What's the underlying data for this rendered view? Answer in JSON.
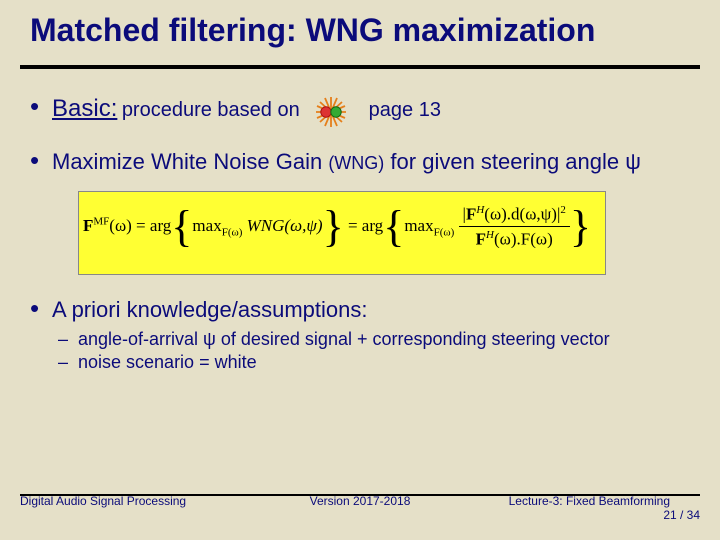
{
  "title": "Matched filtering: WNG maximization",
  "bullets": {
    "b1": {
      "basic_label": "Basic:",
      "basic_rest": "procedure based on",
      "page_ref": "page 13"
    },
    "b2": {
      "pre": "Maximize White Noise Gain",
      "wng": "(WNG)",
      "post": "for given steering angle ψ"
    },
    "b3": {
      "label": "A priori knowledge/assumptions:",
      "sub1": "angle-of-arrival ψ of desired signal + corresponding steering vector",
      "sub2": "noise scenario = white"
    }
  },
  "equation": {
    "lhs": "F",
    "lhs_sup": "MF",
    "omega": "(ω) = arg",
    "max1_pre": "max",
    "max1_sub": "F(ω)",
    "wng": " WNG(ω,ψ)",
    "mid": " = arg",
    "max2_pre": "max",
    "max2_sub": "F(ω)",
    "num_left": "|",
    "num_body": "F",
    "num_Hsup": "H",
    "num_rest": "(ω).d(ω,ψ)",
    "num_sqsup": "2",
    "den_left": "F",
    "den_Hsup": "H",
    "den_mid": "(ω).F(ω)"
  },
  "footer": {
    "left": "Digital Audio Signal Processing",
    "mid": "Version 2017-2018",
    "right": "Lecture-3: Fixed Beamforming",
    "page": "21 / 34"
  },
  "chart_data": {
    "type": "table",
    "title": "Matched filtering: WNG maximization",
    "slide_number": 21,
    "slide_total": 34,
    "referenced_page": 13,
    "objective": "Maximize White Noise Gain (WNG) for given steering angle ψ",
    "formula_tex": "F^{MF}(\\omega)=\\arg\\{\\max_{F(\\omega)} WNG(\\omega,\\psi)\\}=\\arg\\{\\max_{F(\\omega)} \\frac{|F^{H}(\\omega)\\,d(\\omega,\\psi)|^{2}}{F^{H}(\\omega)\\,F(\\omega)}\\}",
    "assumptions": [
      "angle-of-arrival ψ of desired signal + corresponding steering vector",
      "noise scenario = white"
    ]
  }
}
